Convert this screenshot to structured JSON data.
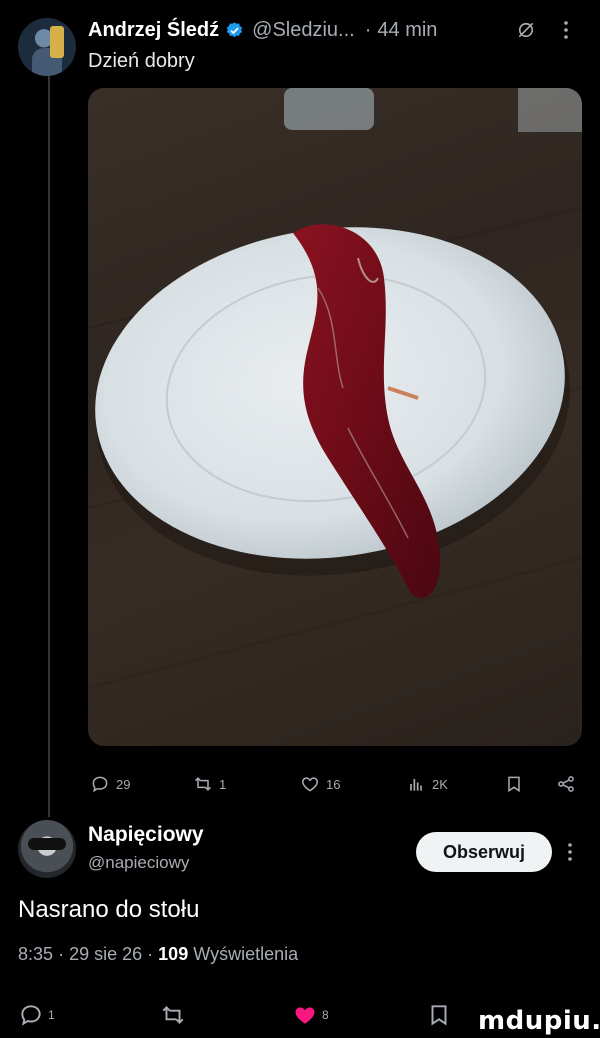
{
  "post": {
    "author_name": "Andrzej Śledź",
    "author_handle": "@Sledziu...",
    "time": "44 min",
    "separator": "·",
    "text": "Dzień dobry",
    "stats": {
      "replies": "29",
      "reposts": "1",
      "likes": "16",
      "views": "2K"
    }
  },
  "reply": {
    "author_name": "Napięciowy",
    "author_handle": "@napieciowy",
    "follow_label": "Obserwuj",
    "text": "Nasrano do stołu",
    "time": "8:35",
    "separator": "·",
    "date": "29 sie 26",
    "views_count": "109",
    "views_label": "Wyświetlenia",
    "stats": {
      "replies": "1",
      "likes": "8"
    }
  },
  "watermark": "mdupiu.pl",
  "colors": {
    "background": "#000000",
    "text_primary": "#e7e9ea",
    "text_secondary": "#a8adb3",
    "verified": "#1d9bf0",
    "like_active": "#f91880",
    "follow_button_bg": "#eff3f4"
  },
  "icons": {
    "verified": "verified-badge-icon",
    "grok": "grok-icon",
    "more": "more-icon",
    "reply": "reply-icon",
    "repost": "repost-icon",
    "like": "heart-icon",
    "views": "views-icon",
    "bookmark": "bookmark-icon",
    "share": "share-icon"
  }
}
